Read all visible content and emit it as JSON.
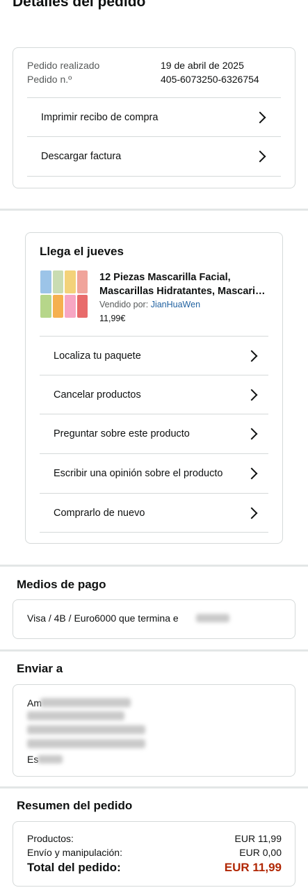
{
  "page": {
    "title": "Detalles del pedido"
  },
  "order": {
    "placed_label": "Pedido realizado",
    "placed_value": "19 de abril de 2025",
    "number_label": "Pedido n.º",
    "number_value": "405-6073250-6326754",
    "links": [
      "Imprimir recibo de compra",
      "Descargar factura"
    ]
  },
  "shipment": {
    "heading": "Llega el jueves",
    "product_title_line1": "12 Piezas Mascarilla Facial,",
    "product_title_line2": "Mascarillas Hidratantes, Mascari…",
    "sold_by_label": "Vendido por:",
    "seller": "JianHuaWen",
    "price": "11,99€",
    "actions": [
      "Localiza tu paquete",
      "Cancelar productos",
      "Preguntar sobre este producto",
      "Escribir una opinión sobre el producto",
      "Comprarlo de nuevo"
    ]
  },
  "payment": {
    "heading": "Medios de pago",
    "method": "Visa / 4B / Euro6000  que termina e"
  },
  "shipping": {
    "heading": "Enviar a",
    "line_first": "Am",
    "line_last": "Es"
  },
  "summary": {
    "heading": "Resumen del pedido",
    "products_label": "Productos:",
    "products_value": "EUR 11,99",
    "shipping_label": "Envío y manipulación:",
    "shipping_value": "EUR 0,00",
    "total_label": "Total del pedido:",
    "total_value": "EUR 11,99"
  }
}
